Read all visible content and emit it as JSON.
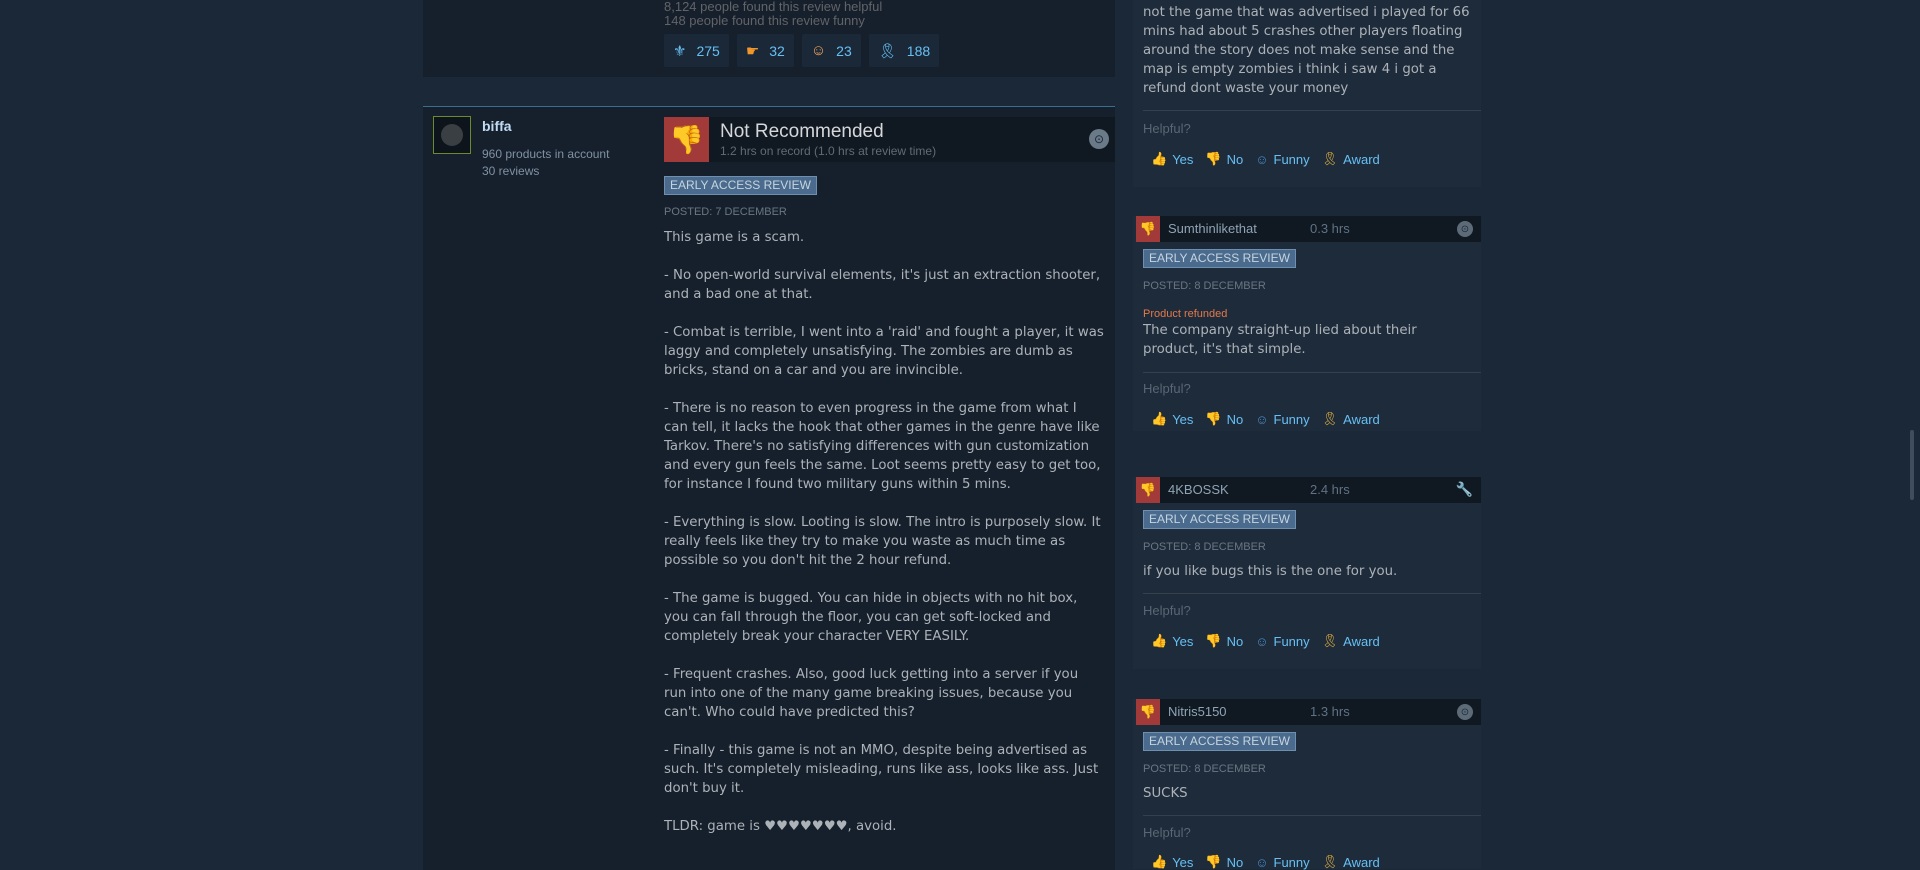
{
  "previous_review": {
    "helpful": "8,124 people found this review helpful",
    "funny": "148 people found this review funny",
    "awards": [
      {
        "icon": "wings-award-icon",
        "glyph": "⚜",
        "count": "275"
      },
      {
        "icon": "hand-award-icon",
        "glyph": "☛",
        "count": "32"
      },
      {
        "icon": "clown-award-icon",
        "glyph": "☺",
        "count": "23"
      },
      {
        "icon": "ribbon-award-icon",
        "glyph": "🎗",
        "count": "188"
      }
    ]
  },
  "main_review": {
    "author": {
      "name": "biffa",
      "products": "960 products in account",
      "reviews": "30 reviews"
    },
    "verdict": "Not Recommended",
    "hours": "1.2 hrs on record (1.0 hrs at review time)",
    "tag": "EARLY ACCESS REVIEW",
    "posted": "POSTED: 7 DECEMBER",
    "paragraphs": [
      "This game is a scam.",
      "- No open-world survival elements, it's just an extraction shooter, and a bad one at that.",
      "- Combat is terrible, I went into a 'raid' and fought a player, it was laggy and completely unsatisfying. The zombies are dumb as bricks, stand on a car and you are invincible.",
      "- There is no reason to even progress in the game from what I can tell, it lacks the hook that other games in the genre have like Tarkov. There's no satisfying differences with gun customization and every gun feels the same. Loot seems pretty easy to get too, for instance I found two military guns within 5 mins.",
      "- Everything is slow. Looting is slow. The intro is purposely slow. It really feels like they try to make you waste as much time as possible so you don't hit the 2 hour refund.",
      "- The game is bugged. You can hide in objects with no hit box, you can fall through the floor, you can get soft-locked and completely break your character VERY EASILY.",
      "- Frequent crashes. Also, good luck getting into a server if you run into one of the many game breaking issues, because you can't. Who could have predicted this?",
      "- Finally - this game is not an MMO, despite being advertised as such. It's completely misleading, runs like ass, looks like ass. Just don't buy it.",
      "TLDR: game is ♥♥♥♥♥♥♥, avoid."
    ]
  },
  "side": {
    "top_review_text": "not the game that was advertised i played for 66 mins had about 5 crashes other players floating around the story does not make sense and the map is empty zombies i think i saw 4 i got a refund dont waste your money",
    "helpful_label": "Helpful?",
    "buttons": {
      "yes": "Yes",
      "no": "No",
      "funny": "Funny",
      "award": "Award"
    },
    "reviews": [
      {
        "name": "Sumthinlikethat",
        "hours": "0.3 hrs",
        "tag": "EARLY ACCESS REVIEW",
        "posted": "POSTED: 8 DECEMBER",
        "refunded": "Product refunded",
        "text": "The company straight-up lied about their product, it's that simple."
      },
      {
        "name": "4KBOSSK",
        "hours": "2.4 hrs",
        "tag": "EARLY ACCESS REVIEW",
        "posted": "POSTED: 8 DECEMBER",
        "text": "if you like bugs this is the one for you."
      },
      {
        "name": "Nitris5150",
        "hours": "1.3 hrs",
        "tag": "EARLY ACCESS REVIEW",
        "posted": "POSTED: 8 DECEMBER",
        "text": "SUCKS"
      }
    ]
  }
}
